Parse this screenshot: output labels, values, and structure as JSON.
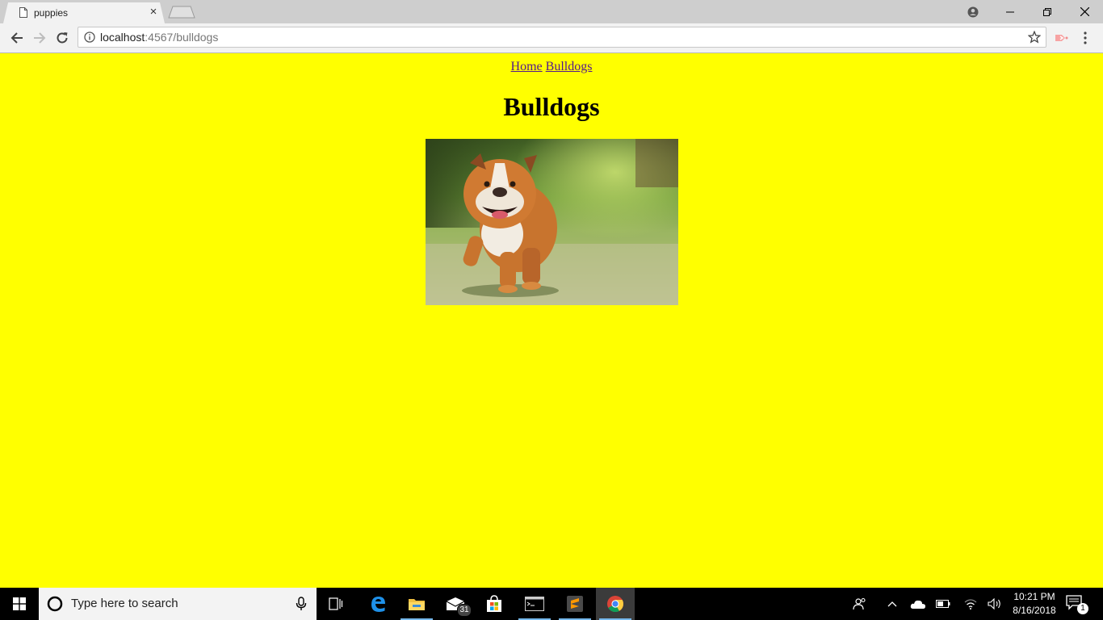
{
  "browser": {
    "tab_title": "puppies",
    "tab_close": "×",
    "url_host": "localhost",
    "url_rest": ":4567/bulldogs"
  },
  "page": {
    "nav_links": [
      "Home",
      "Bulldogs"
    ],
    "title": "Bulldogs",
    "background_color": "#ffff00",
    "image_subject": "bulldog running on grass"
  },
  "taskbar": {
    "search_placeholder": "Type here to search",
    "mail_badge": "31",
    "time": "10:21 PM",
    "date": "8/16/2018",
    "notification_count": "1"
  }
}
